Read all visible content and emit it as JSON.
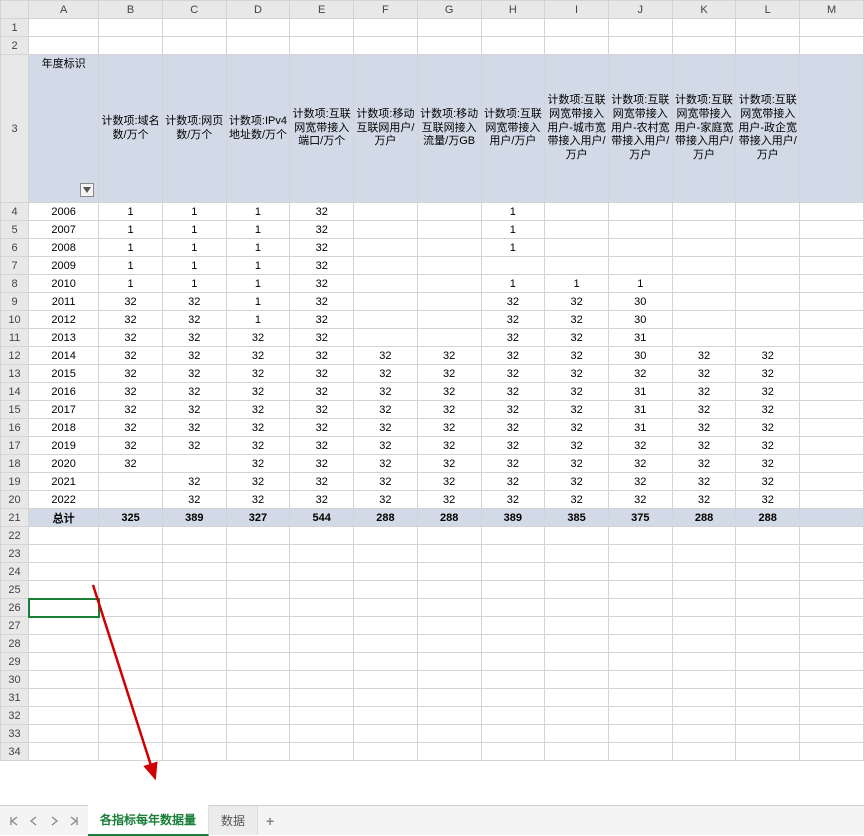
{
  "columns": [
    "A",
    "B",
    "C",
    "D",
    "E",
    "F",
    "G",
    "H",
    "I",
    "J",
    "K",
    "L",
    "M"
  ],
  "headers": {
    "A": "年度标识",
    "B": "计数项:域名数/万个",
    "C": "计数项:网页数/万个",
    "D": "计数项:IPv4地址数/万个",
    "E": "计数项:互联网宽带接入端口/万个",
    "F": "计数项:移动互联网用户/万户",
    "G": "计数项:移动互联网接入流量/万GB",
    "H": "计数项:互联网宽带接入用户/万户",
    "I": "计数项:互联网宽带接入用户-城市宽带接入用户/万户",
    "J": "计数项:互联网宽带接入用户-农村宽带接入用户/万户",
    "K": "计数项:互联网宽带接入用户-家庭宽带接入用户/万户",
    "L": "计数项:互联网宽带接入用户-政企宽带接入用户/万户"
  },
  "rows": [
    {
      "n": 4,
      "A": "2006",
      "B": "1",
      "C": "1",
      "D": "1",
      "E": "32",
      "F": "",
      "G": "",
      "H": "1",
      "I": "",
      "J": "",
      "K": "",
      "L": ""
    },
    {
      "n": 5,
      "A": "2007",
      "B": "1",
      "C": "1",
      "D": "1",
      "E": "32",
      "F": "",
      "G": "",
      "H": "1",
      "I": "",
      "J": "",
      "K": "",
      "L": ""
    },
    {
      "n": 6,
      "A": "2008",
      "B": "1",
      "C": "1",
      "D": "1",
      "E": "32",
      "F": "",
      "G": "",
      "H": "1",
      "I": "",
      "J": "",
      "K": "",
      "L": ""
    },
    {
      "n": 7,
      "A": "2009",
      "B": "1",
      "C": "1",
      "D": "1",
      "E": "32",
      "F": "",
      "G": "",
      "H": "",
      "I": "",
      "J": "",
      "K": "",
      "L": ""
    },
    {
      "n": 8,
      "A": "2010",
      "B": "1",
      "C": "1",
      "D": "1",
      "E": "32",
      "F": "",
      "G": "",
      "H": "1",
      "I": "1",
      "J": "1",
      "K": "",
      "L": ""
    },
    {
      "n": 9,
      "A": "2011",
      "B": "32",
      "C": "32",
      "D": "1",
      "E": "32",
      "F": "",
      "G": "",
      "H": "32",
      "I": "32",
      "J": "30",
      "K": "",
      "L": ""
    },
    {
      "n": 10,
      "A": "2012",
      "B": "32",
      "C": "32",
      "D": "1",
      "E": "32",
      "F": "",
      "G": "",
      "H": "32",
      "I": "32",
      "J": "30",
      "K": "",
      "L": ""
    },
    {
      "n": 11,
      "A": "2013",
      "B": "32",
      "C": "32",
      "D": "32",
      "E": "32",
      "F": "",
      "G": "",
      "H": "32",
      "I": "32",
      "J": "31",
      "K": "",
      "L": ""
    },
    {
      "n": 12,
      "A": "2014",
      "B": "32",
      "C": "32",
      "D": "32",
      "E": "32",
      "F": "32",
      "G": "32",
      "H": "32",
      "I": "32",
      "J": "30",
      "K": "32",
      "L": "32"
    },
    {
      "n": 13,
      "A": "2015",
      "B": "32",
      "C": "32",
      "D": "32",
      "E": "32",
      "F": "32",
      "G": "32",
      "H": "32",
      "I": "32",
      "J": "32",
      "K": "32",
      "L": "32"
    },
    {
      "n": 14,
      "A": "2016",
      "B": "32",
      "C": "32",
      "D": "32",
      "E": "32",
      "F": "32",
      "G": "32",
      "H": "32",
      "I": "32",
      "J": "31",
      "K": "32",
      "L": "32"
    },
    {
      "n": 15,
      "A": "2017",
      "B": "32",
      "C": "32",
      "D": "32",
      "E": "32",
      "F": "32",
      "G": "32",
      "H": "32",
      "I": "32",
      "J": "31",
      "K": "32",
      "L": "32"
    },
    {
      "n": 16,
      "A": "2018",
      "B": "32",
      "C": "32",
      "D": "32",
      "E": "32",
      "F": "32",
      "G": "32",
      "H": "32",
      "I": "32",
      "J": "31",
      "K": "32",
      "L": "32"
    },
    {
      "n": 17,
      "A": "2019",
      "B": "32",
      "C": "32",
      "D": "32",
      "E": "32",
      "F": "32",
      "G": "32",
      "H": "32",
      "I": "32",
      "J": "32",
      "K": "32",
      "L": "32"
    },
    {
      "n": 18,
      "A": "2020",
      "B": "32",
      "C": "",
      "D": "32",
      "E": "32",
      "F": "32",
      "G": "32",
      "H": "32",
      "I": "32",
      "J": "32",
      "K": "32",
      "L": "32"
    },
    {
      "n": 19,
      "A": "2021",
      "B": "",
      "C": "32",
      "D": "32",
      "E": "32",
      "F": "32",
      "G": "32",
      "H": "32",
      "I": "32",
      "J": "32",
      "K": "32",
      "L": "32"
    },
    {
      "n": 20,
      "A": "2022",
      "B": "",
      "C": "32",
      "D": "32",
      "E": "32",
      "F": "32",
      "G": "32",
      "H": "32",
      "I": "32",
      "J": "32",
      "K": "32",
      "L": "32"
    }
  ],
  "total": {
    "label": "总计",
    "B": "325",
    "C": "389",
    "D": "327",
    "E": "544",
    "F": "288",
    "G": "288",
    "H": "389",
    "I": "385",
    "J": "375",
    "K": "288",
    "L": "288"
  },
  "emptyRows": [
    22,
    23,
    24,
    25,
    26,
    27,
    28,
    29,
    30,
    31,
    32,
    33,
    34
  ],
  "activeRow": 26,
  "tabs": {
    "active": "各指标每年数据量",
    "other": "数据"
  }
}
